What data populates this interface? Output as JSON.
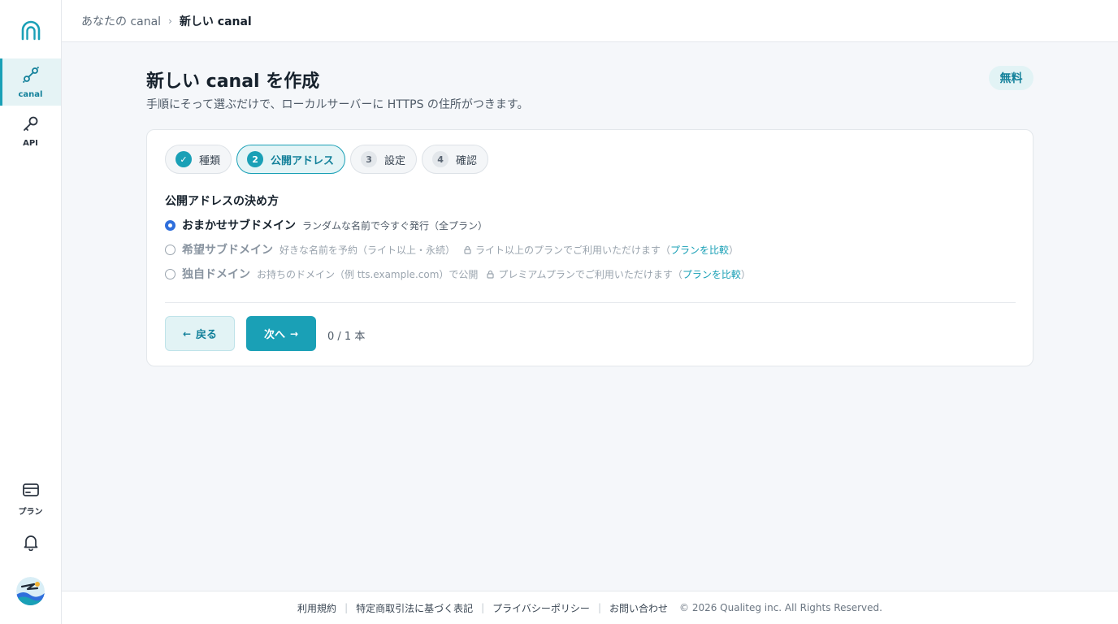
{
  "sidebar": {
    "logo_icon": "canal-arch-icon",
    "items": [
      {
        "label": "canal",
        "icon": "link-icon",
        "active": true
      },
      {
        "label": "API",
        "icon": "key-icon"
      },
      {
        "label": "プラン",
        "icon": "card-icon"
      }
    ],
    "bell_icon": "bell-icon",
    "avatar_icon": "avatar-icon"
  },
  "breadcrumb": {
    "parent": "あなたの canal",
    "separator": "›",
    "current": "新しい canal"
  },
  "page": {
    "title": "新しい canal を作成",
    "subtitle": "手順にそって選ぶだけで、ローカルサーバーに HTTPS の住所がつきます。",
    "badge": "無料"
  },
  "steps": [
    {
      "num": "✓",
      "label": "種類",
      "state": "done"
    },
    {
      "num": "2",
      "label": "公開アドレス",
      "state": "current"
    },
    {
      "num": "3",
      "label": "設定",
      "state": "todo"
    },
    {
      "num": "4",
      "label": "確認",
      "state": "todo"
    }
  ],
  "section": {
    "title": "公開アドレスの決め方"
  },
  "options": [
    {
      "title": "おまかせサブドメイン",
      "desc": "ランダムな名前で今すぐ発行（全プラン）",
      "checked": true
    },
    {
      "title": "希望サブドメイン",
      "desc": "好きな名前を予約（ライト以上・永続）",
      "note": "ライト以上のプランでご利用いただけます（",
      "link": "プランを比較",
      "note_end": "）",
      "checked": false
    },
    {
      "title": "独自ドメイン",
      "desc": "お持ちのドメイン（例 tts.example.com）で公開",
      "note": "プレミアムプランでご利用いただけます（",
      "link": "プランを比較",
      "note_end": "）",
      "checked": false
    }
  ],
  "actions": {
    "back_arrow": "←",
    "back_label": "戻る",
    "next_label": "次へ",
    "next_arrow": "→",
    "count": "0 / 1 本"
  },
  "footer": {
    "links": [
      "利用規約",
      "特定商取引法に基づく表記",
      "プライバシーポリシー",
      "お問い合わせ"
    ],
    "separator": "|",
    "copyright": "© 2026 Qualiteg inc. All Rights Reserved."
  },
  "colors": {
    "accent": "#1aa0b6",
    "accent_light": "#e2f3f5",
    "radio_checked": "#2f6fdc"
  }
}
